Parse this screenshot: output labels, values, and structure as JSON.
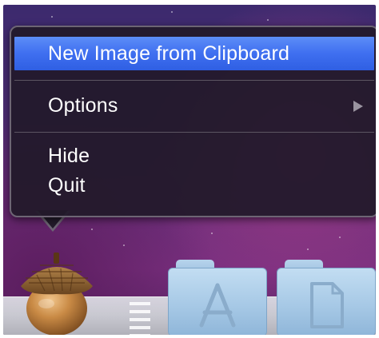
{
  "context_menu": {
    "items": [
      {
        "label": "New Image from Clipboard",
        "highlighted": true
      },
      {
        "label": "Options",
        "has_submenu": true
      },
      {
        "label": "Hide"
      },
      {
        "label": "Quit"
      }
    ],
    "highlight_color": "#3f6ff0",
    "background_color": "#221a2a"
  },
  "dock": {
    "items": [
      {
        "name": "acorn-app-icon"
      },
      {
        "name": "applications-folder-icon"
      },
      {
        "name": "documents-folder-icon"
      }
    ]
  },
  "icons": {
    "submenu_arrow": "chevron-right-icon",
    "applications_glyph": "app-store-a-icon",
    "documents_glyph": "document-page-icon"
  }
}
